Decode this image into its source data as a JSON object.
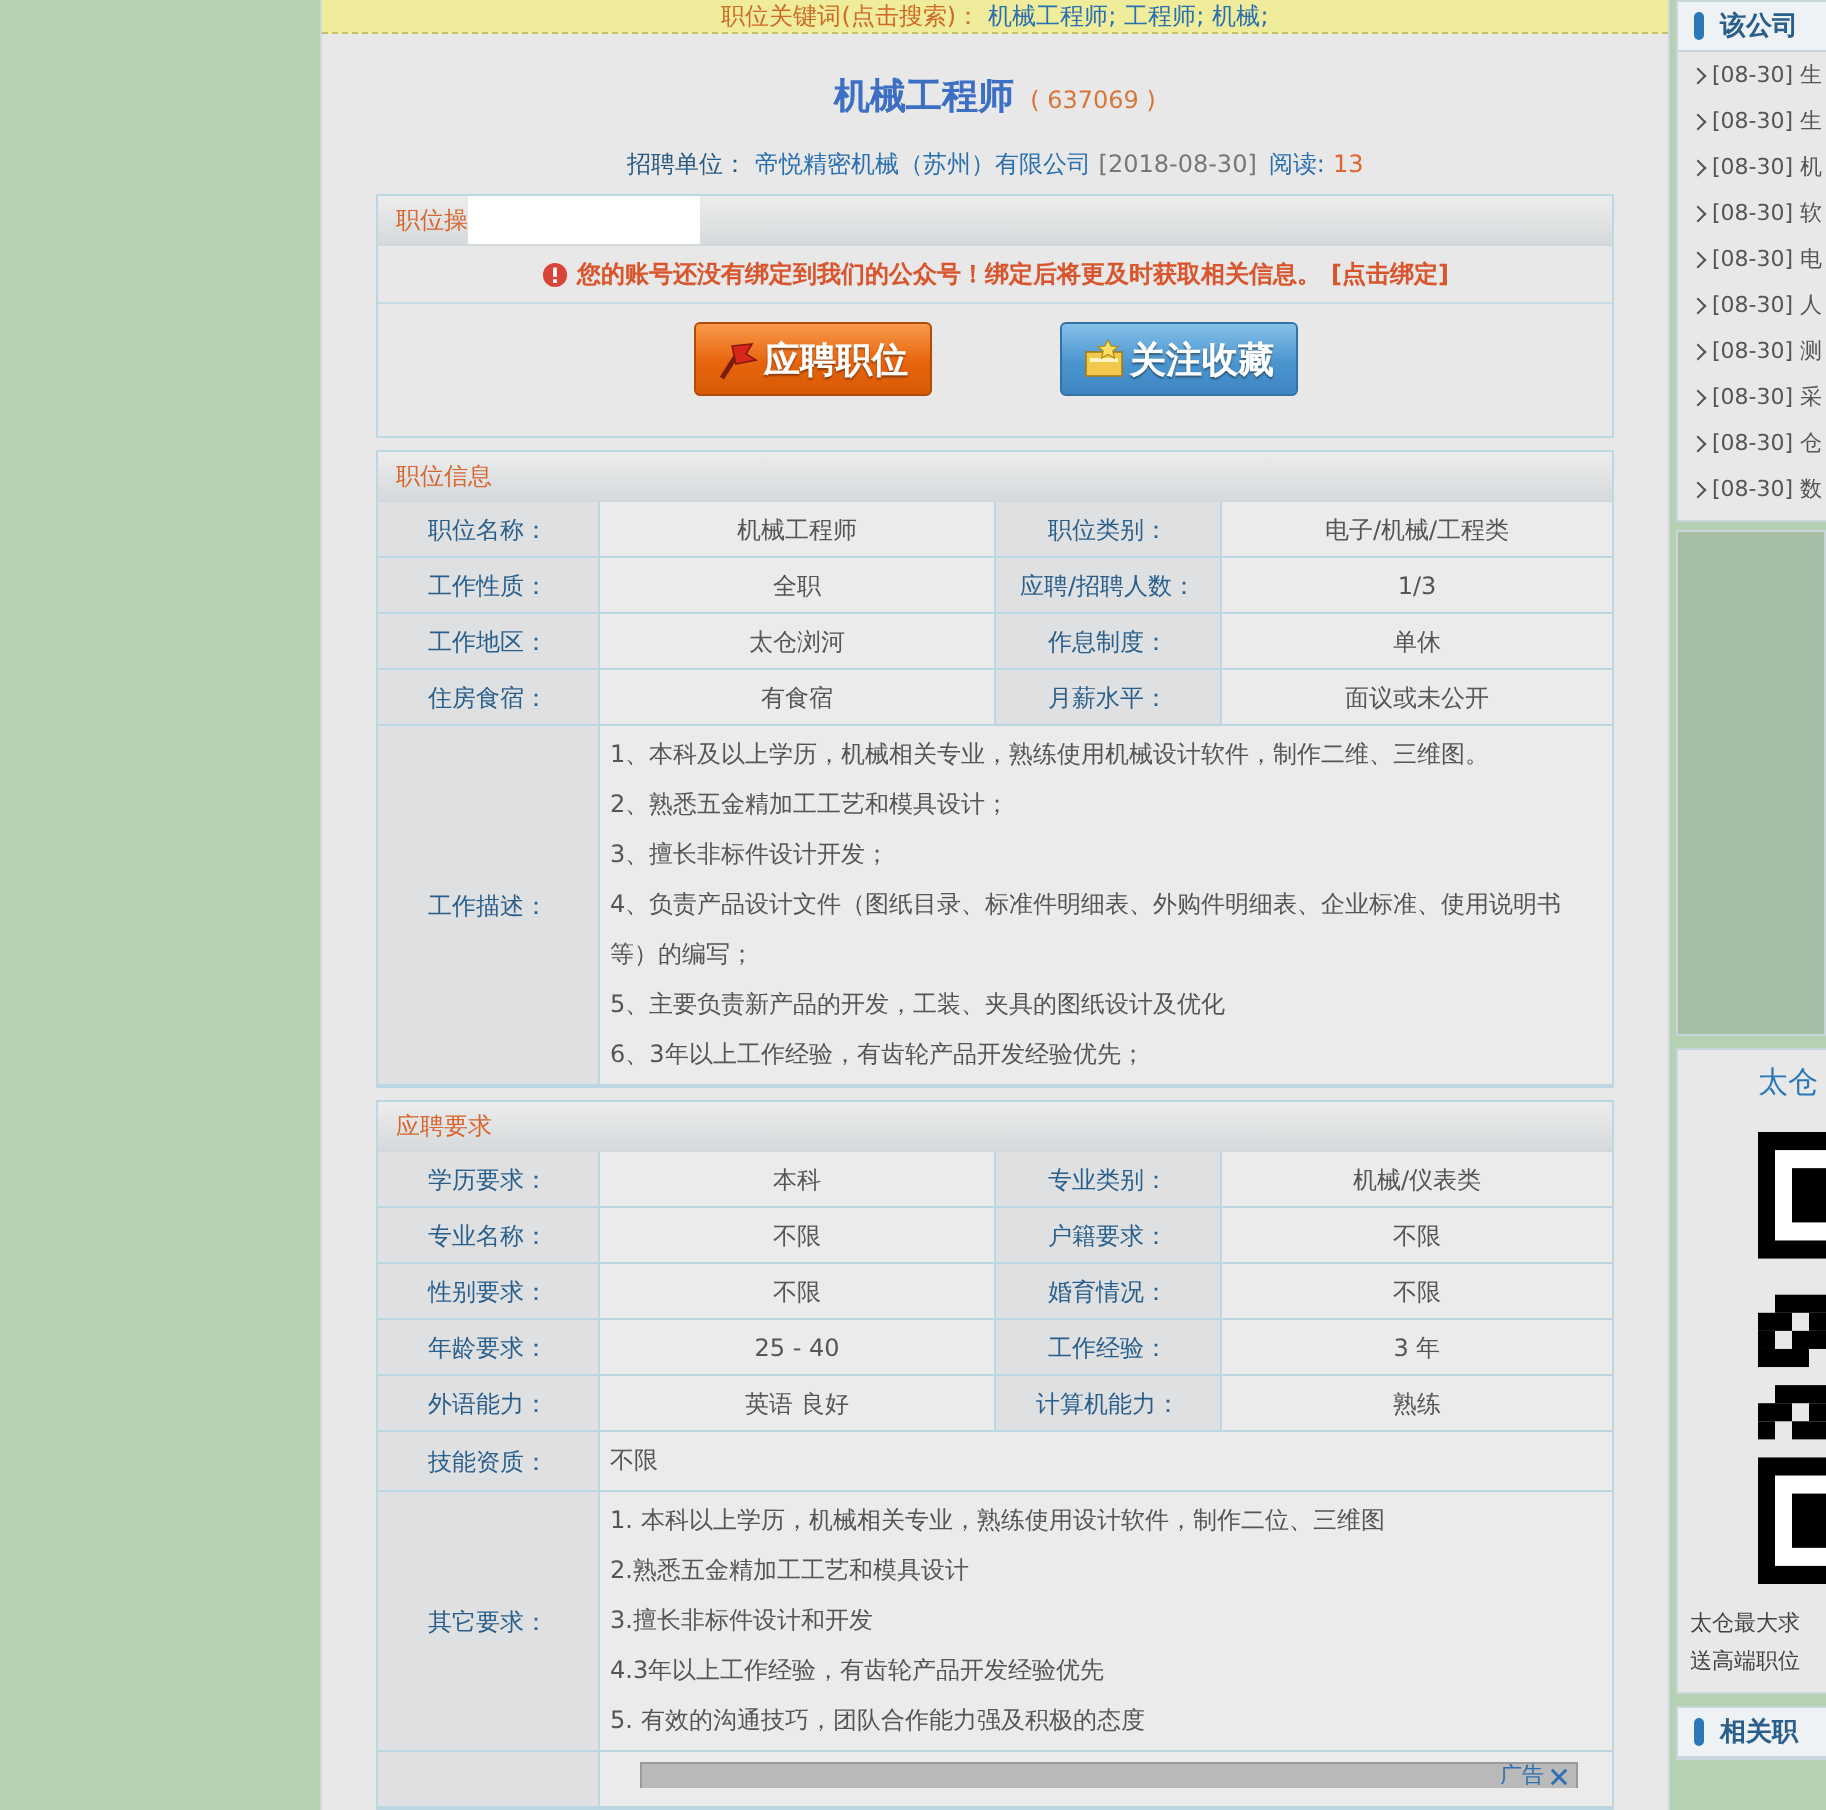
{
  "keyword_bar": {
    "label": "职位关键词(点击搜索)：",
    "keywords": [
      "机械工程师;",
      "工程师;",
      "机械;"
    ]
  },
  "job": {
    "title": "机械工程师",
    "id": "( 637069 )"
  },
  "meta": {
    "company_label": "招聘单位：",
    "company": "帝悦精密机械（苏州）有限公司",
    "date": "[2018-08-30]",
    "views_label": "阅读:",
    "views": "13"
  },
  "actions_panel": {
    "title": "职位操",
    "alert": "您的账号还没有绑定到我们的公众号！绑定后将更及时获取相关信息。",
    "alert_link": "[点击绑定]",
    "buttons": [
      {
        "kind": "apply",
        "label": "应聘职位"
      },
      {
        "kind": "favorite",
        "label": "关注收藏"
      }
    ]
  },
  "sections": [
    {
      "title": "职位信息",
      "rows": [
        {
          "kind": "pair",
          "cells": [
            "职位名称：",
            "机械工程师",
            "职位类别：",
            "电子/机械/工程类"
          ]
        },
        {
          "kind": "pair",
          "cells": [
            "工作性质：",
            "全职",
            "应聘/招聘人数：",
            "1/3"
          ]
        },
        {
          "kind": "pair",
          "cells": [
            "工作地区：",
            "太仓浏河",
            "作息制度：",
            "单休"
          ]
        },
        {
          "kind": "pair",
          "cells": [
            "住房食宿：",
            "有食宿",
            "月薪水平：",
            "面议或未公开"
          ]
        },
        {
          "kind": "list",
          "label": "工作描述：",
          "lines": [
            "1、本科及以上学历，机械相关专业，熟练使用机械设计软件，制作二维、三维图。",
            "2、熟悉五金精加工工艺和模具设计；",
            "3、擅长非标件设计开发；",
            "4、负责产品设计文件（图纸目录、标准件明细表、外购件明细表、企业标准、使用说明书等）的编写；",
            "5、主要负责新产品的开发，工装、夹具的图纸设计及优化",
            "6、3年以上工作经验，有齿轮产品开发经验优先；"
          ]
        }
      ]
    },
    {
      "title": "应聘要求",
      "rows": [
        {
          "kind": "pair",
          "cells": [
            "学历要求：",
            "本科",
            "专业类别：",
            "机械/仪表类"
          ]
        },
        {
          "kind": "pair",
          "cells": [
            "专业名称：",
            "不限",
            "户籍要求：",
            "不限"
          ]
        },
        {
          "kind": "pair",
          "cells": [
            "性别要求：",
            "不限",
            "婚育情况：",
            "不限"
          ]
        },
        {
          "kind": "pair",
          "cells": [
            "年龄要求：",
            "25 - 40",
            "工作经验：",
            "3 年"
          ]
        },
        {
          "kind": "pair",
          "cells": [
            "外语能力：",
            "英语 良好",
            "计算机能力：",
            "熟练"
          ]
        },
        {
          "kind": "list",
          "label": "技能资质：",
          "lines": [
            "不限"
          ]
        },
        {
          "kind": "list",
          "label": "其它要求：",
          "lines": [
            "1. 本科以上学历，机械相关专业，熟练使用设计软件，制作二位、三维图",
            "2.熟悉五金精加工工艺和模具设计",
            "3.擅长非标件设计和开发",
            "4.3年以上工作经验，有齿轮产品开发经验优先",
            "5. 有效的沟通技巧，团队合作能力强及积极的态度"
          ]
        },
        {
          "kind": "ad",
          "label": "广告"
        }
      ]
    }
  ],
  "sidebar": {
    "company_jobs": {
      "title": "该公司",
      "items": [
        {
          "date": "[08-30]",
          "title": "生"
        },
        {
          "date": "[08-30]",
          "title": "生"
        },
        {
          "date": "[08-30]",
          "title": "机"
        },
        {
          "date": "[08-30]",
          "title": "软"
        },
        {
          "date": "[08-30]",
          "title": "电"
        },
        {
          "date": "[08-30]",
          "title": "人"
        },
        {
          "date": "[08-30]",
          "title": "测"
        },
        {
          "date": "[08-30]",
          "title": "采"
        },
        {
          "date": "[08-30]",
          "title": "仓"
        },
        {
          "date": "[08-30]",
          "title": "数"
        }
      ]
    },
    "qr_panel": {
      "title": "太仓",
      "lines": [
        "太仓最大求",
        "送高端职位"
      ]
    },
    "related": {
      "title": "相关职"
    }
  }
}
